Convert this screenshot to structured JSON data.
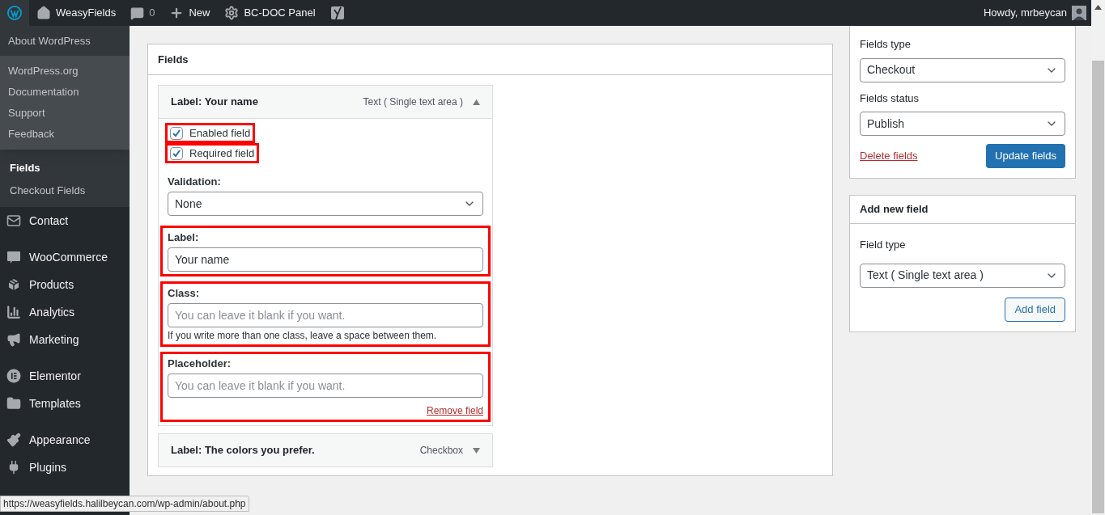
{
  "admin_bar": {
    "items": [
      {
        "kind": "logo"
      },
      {
        "kind": "site",
        "label": "WeasyFields"
      },
      {
        "kind": "comments",
        "label": "0"
      },
      {
        "kind": "new",
        "label": "New"
      },
      {
        "kind": "gear",
        "label": "BC-DOC Panel"
      },
      {
        "kind": "seo"
      }
    ],
    "account": "Howdy, mrbeycan"
  },
  "wp_menu": {
    "header": "About WordPress",
    "items": [
      "WordPress.org",
      "Documentation",
      "Support",
      "Feedback"
    ]
  },
  "sidebar": {
    "submenu": [
      {
        "label": "Fields",
        "selected": true
      },
      {
        "label": "Checkout Fields",
        "selected": false
      }
    ],
    "groups": [
      [
        {
          "label": "Contact"
        }
      ],
      [
        {
          "label": "WooCommerce"
        },
        {
          "label": "Products"
        },
        {
          "label": "Analytics"
        },
        {
          "label": "Marketing"
        }
      ],
      [
        {
          "label": "Elementor"
        },
        {
          "label": "Templates"
        }
      ],
      [
        {
          "label": "Appearance"
        },
        {
          "label": "Plugins"
        }
      ]
    ]
  },
  "panel": {
    "title": "Fields",
    "fields": [
      {
        "label": "Label: Your name",
        "type": "Text ( Single text area )",
        "expanded": true,
        "options": [
          {
            "kind": "checkbox",
            "label": "Enabled field",
            "checked": true,
            "highlighted": true
          },
          {
            "kind": "checkbox",
            "label": "Required field",
            "checked": true,
            "highlighted": true
          },
          {
            "kind": "select",
            "label": "Validation:",
            "value": "None",
            "highlighted": false
          },
          {
            "kind": "text",
            "label": "Label:",
            "value": "Your name",
            "highlighted": true
          },
          {
            "kind": "text",
            "label": "Class:",
            "placeholder": "You can leave it blank if you want.",
            "help": "If you write more than one class, leave a space between them.",
            "highlighted": true
          },
          {
            "kind": "text",
            "label": "Placeholder:",
            "placeholder": "You can leave it blank if you want.",
            "link": "Remove field",
            "highlighted": true
          }
        ]
      },
      {
        "label": "Label: The colors you prefer.",
        "type": "Checkbox",
        "expanded": false
      }
    ]
  },
  "settings_box": {
    "fields": [
      {
        "label": "Fields type",
        "value": "Checkout"
      },
      {
        "label": "Fields status",
        "value": "Publish"
      }
    ],
    "delete_link": "Delete fields",
    "button": "Update fields"
  },
  "add_box": {
    "title": "Add new field",
    "field_label": "Field type",
    "value": "Text ( Single text area )",
    "button": "Add field"
  },
  "status_url": "https://weasyfields.halilbeycan.com/wp-admin/about.php"
}
